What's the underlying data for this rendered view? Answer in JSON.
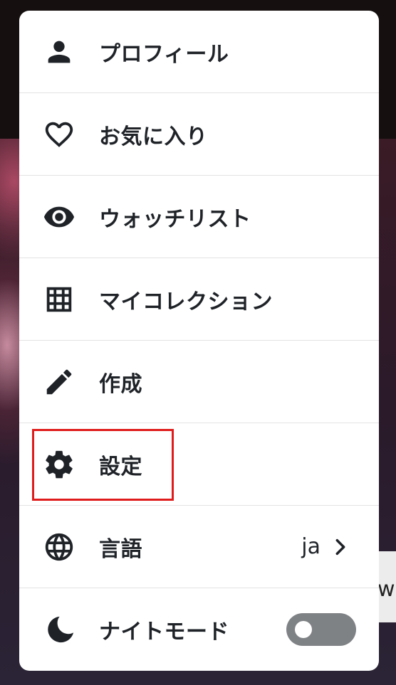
{
  "menu": {
    "items": [
      {
        "id": "profile",
        "label": "プロフィール",
        "icon": "person-icon"
      },
      {
        "id": "favorites",
        "label": "お気に入り",
        "icon": "heart-icon"
      },
      {
        "id": "watchlist",
        "label": "ウォッチリスト",
        "icon": "eye-icon"
      },
      {
        "id": "my-collection",
        "label": "マイコレクション",
        "icon": "grid-icon"
      },
      {
        "id": "create",
        "label": "作成",
        "icon": "pencil-icon"
      },
      {
        "id": "settings",
        "label": "設定",
        "icon": "gear-icon"
      },
      {
        "id": "language",
        "label": "言語",
        "icon": "globe-icon",
        "value": "ja"
      },
      {
        "id": "night-mode",
        "label": "ナイトモード",
        "icon": "moon-icon",
        "toggle_on": false
      }
    ]
  },
  "background": {
    "partial_text": "w"
  },
  "colors": {
    "menu_bg": "#ffffff",
    "text": "#1f2328",
    "divider": "#e3e3e3",
    "toggle_off": "#7f8285",
    "highlight": "#e01b1b"
  }
}
